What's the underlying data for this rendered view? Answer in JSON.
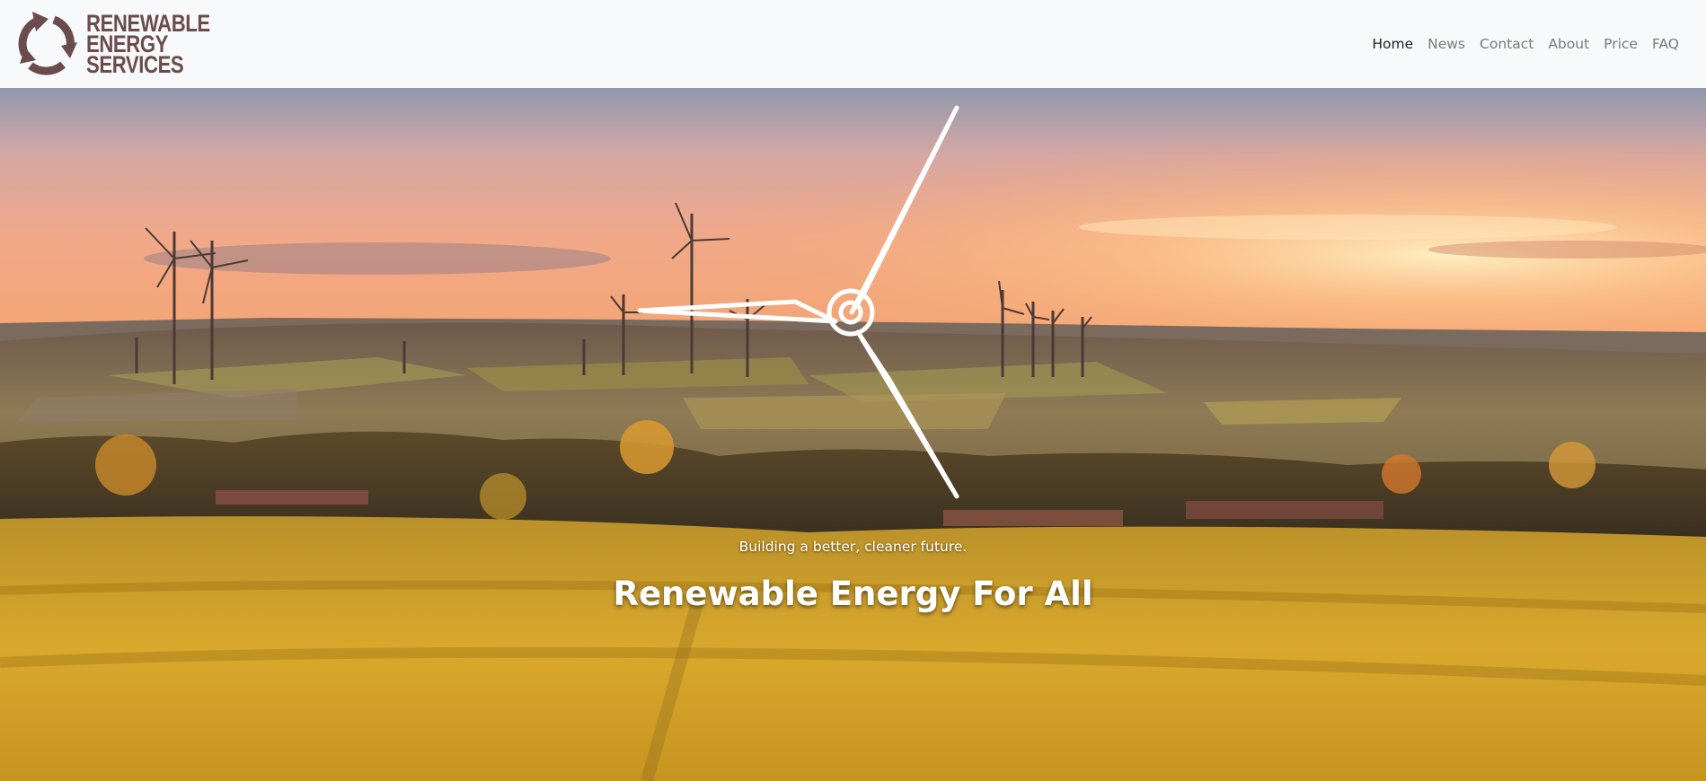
{
  "brand": {
    "line1": "RENEWABLE",
    "line2": "ENERGY",
    "line3": "SERVICES",
    "logo_icon": "recycle-arrows-icon",
    "color": "#6b4c4c"
  },
  "nav": {
    "items": [
      {
        "label": "Home",
        "active": true
      },
      {
        "label": "News",
        "active": false
      },
      {
        "label": "Contact",
        "active": false
      },
      {
        "label": "About",
        "active": false
      },
      {
        "label": "Price",
        "active": false
      },
      {
        "label": "FAQ",
        "active": false
      }
    ]
  },
  "hero": {
    "tagline": "Building a better, cleaner future.",
    "headline": "Renewable Energy For All",
    "turbine_icon": "wind-turbine-icon",
    "background": "sunset-wind-farm-landscape"
  }
}
